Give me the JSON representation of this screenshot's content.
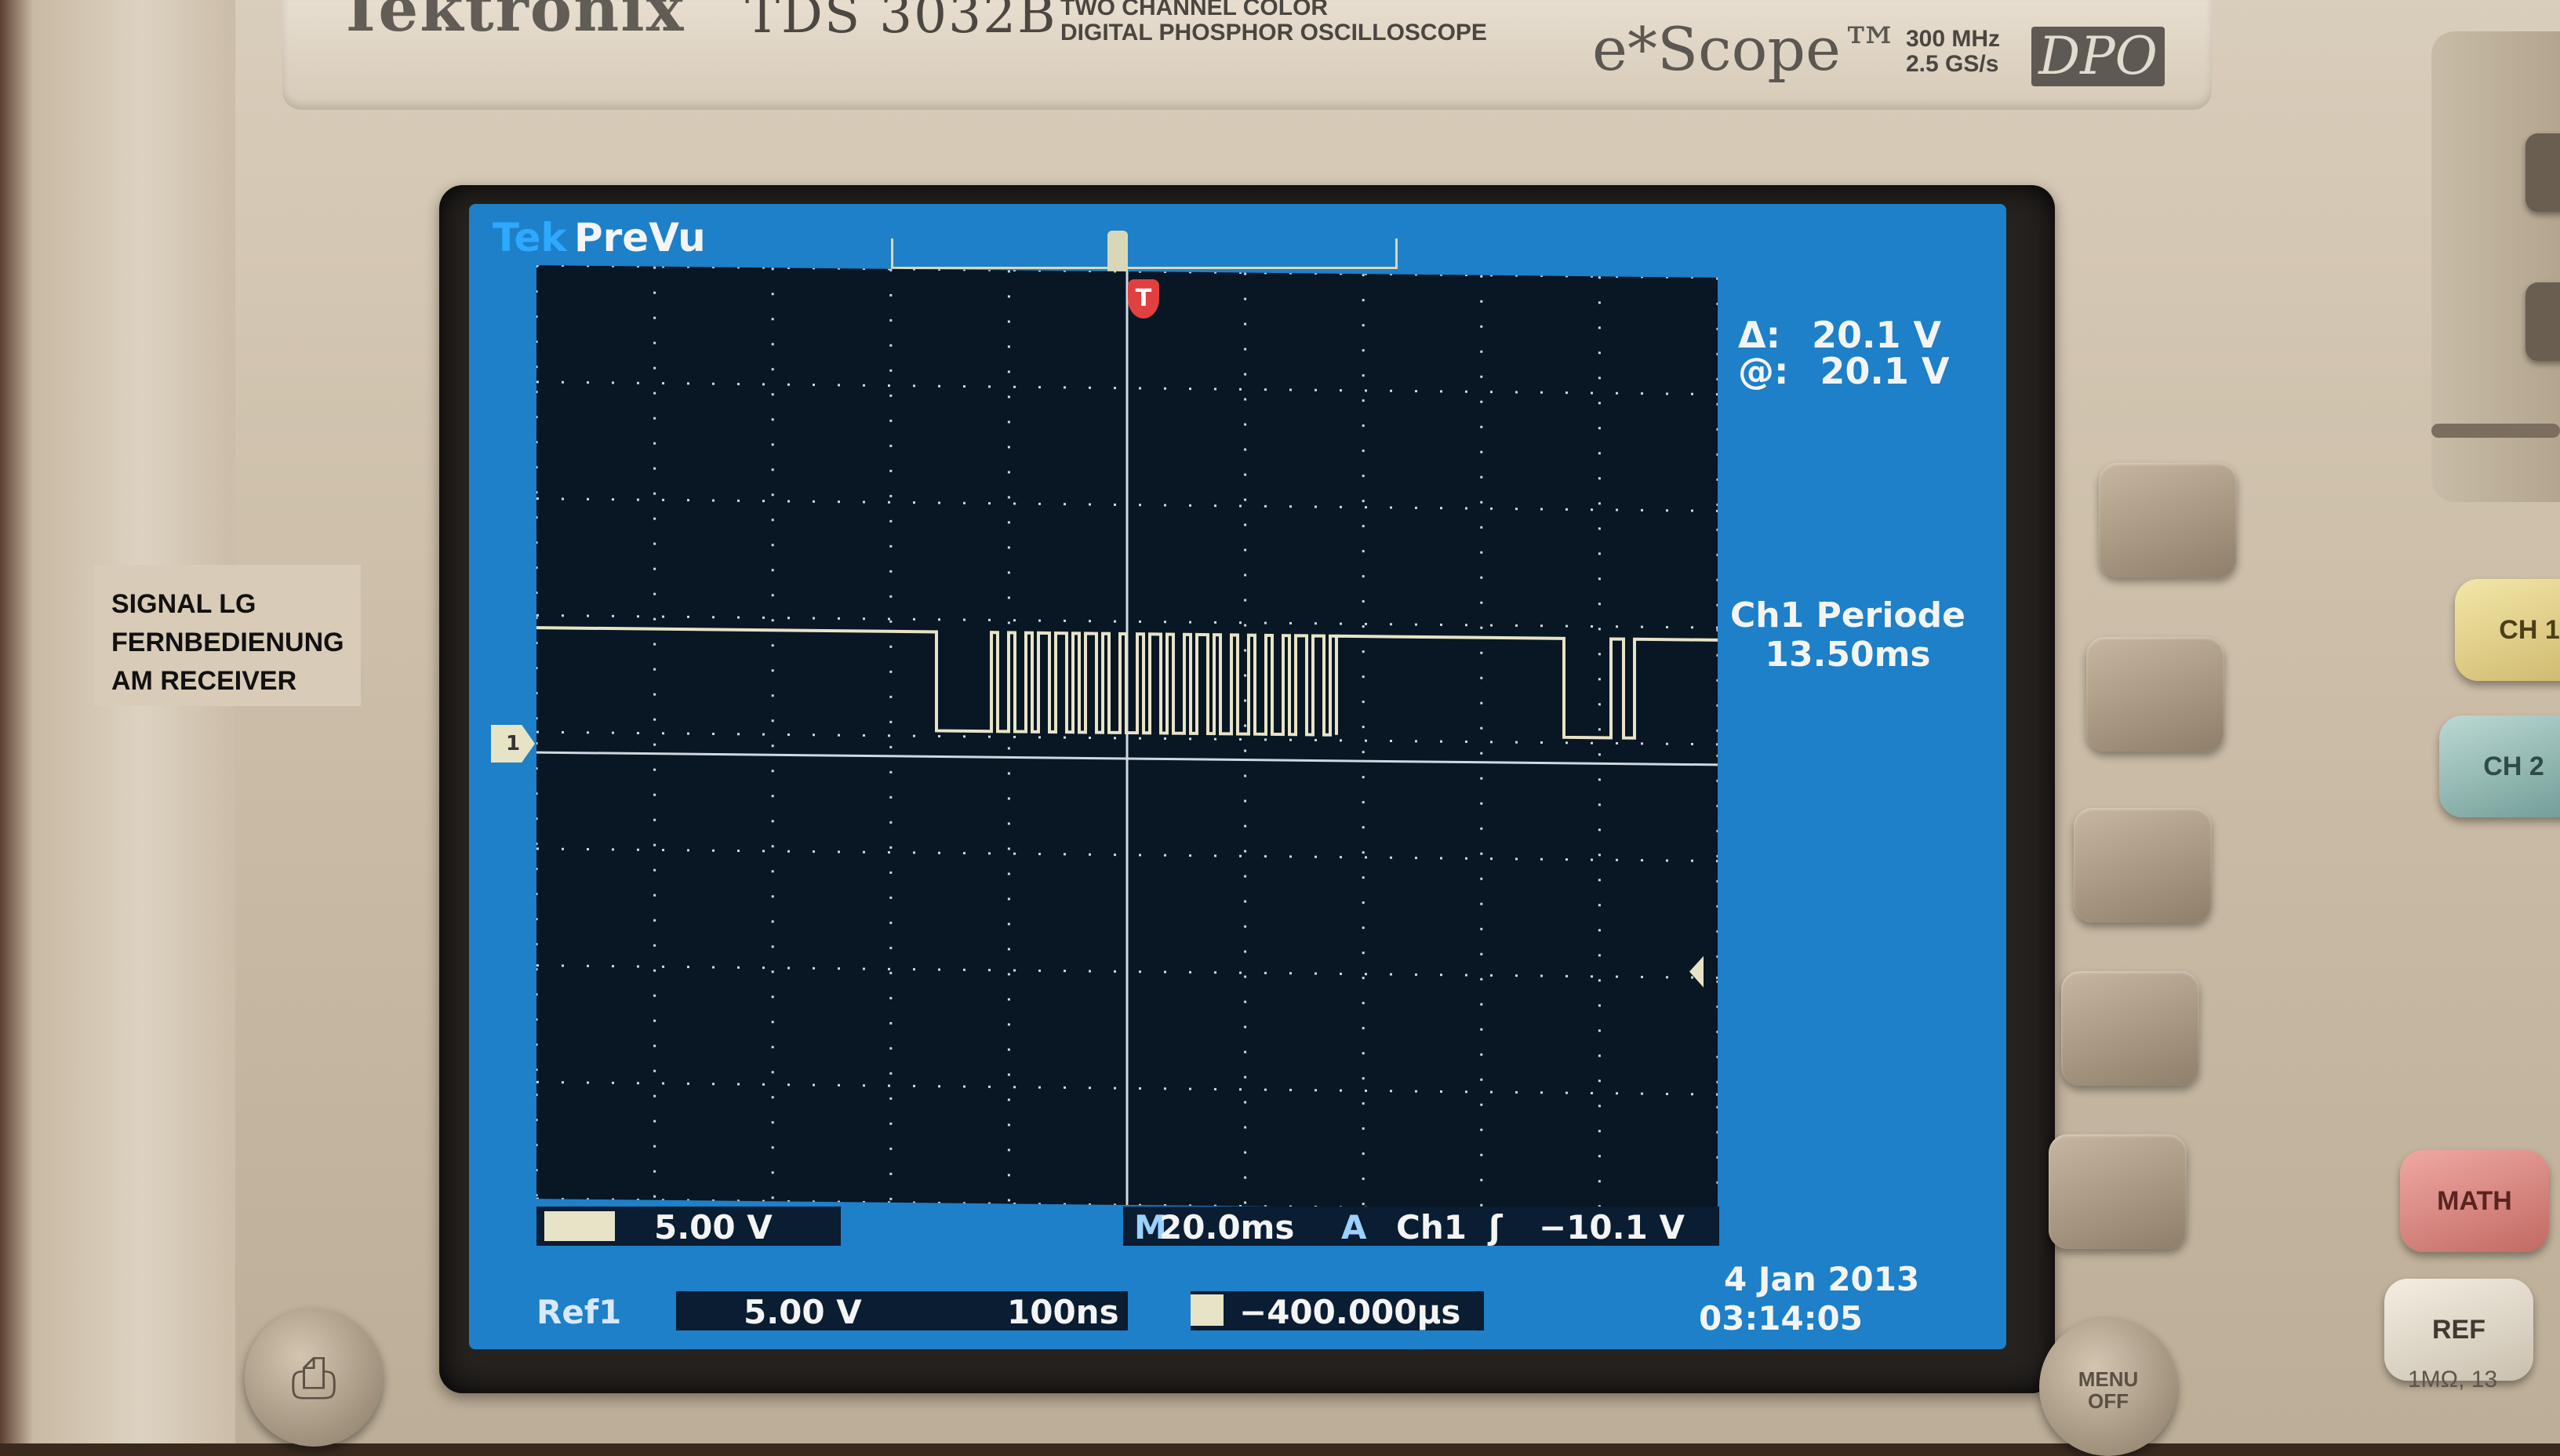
{
  "annotation": {
    "lines": [
      "SIGNAL LG",
      "FERNBEDIENUNG",
      "AM RECEIVER"
    ]
  },
  "scope": {
    "brand": "Tektronix",
    "model": "TDS 3032B",
    "description_line1": "TWO CHANNEL COLOR",
    "description_line2": "DIGITAL PHOSPHOR OSCILLOSCOPE",
    "product_line": "e*Scope™",
    "bandwidth": "300 MHz",
    "sample_rate": "2.5 GS/s",
    "series_badge": "DPO",
    "impedance_label": "1MΩ, 13"
  },
  "screen": {
    "logo": "Tek",
    "mode": "PreVu",
    "trigger_marker": "T",
    "ch1_marker": "1",
    "cursor_delta_label": "Δ:",
    "cursor_delta_value": "20.1 V",
    "cursor_at_label": "@:",
    "cursor_at_value": "20.1 V",
    "measurement_line1": "Ch1 Periode",
    "measurement_line2": "13.50ms",
    "ch1_scale": "5.00 V",
    "horizontal_label": "M",
    "horizontal_scale": "20.0ms",
    "trigger_symbol": "A",
    "trigger_source": "Ch1",
    "trigger_slope": "ʃ",
    "trigger_level": "−10.1 V",
    "ref_label": "Ref1",
    "ref_scale": "5.00 V",
    "ref_time": "100ns",
    "ref_delay": "−400.000µs",
    "date": "4 Jan  2013",
    "time": "03:14:05"
  },
  "buttons": {
    "ch1": "CH 1",
    "ch2": "CH 2",
    "math": "MATH",
    "ref": "REF",
    "menu_line1": "MENU",
    "menu_line2": "OFF",
    "print_icon": "printer-icon"
  },
  "colors": {
    "lcd_background": "#1d80c8",
    "grid_background": "#091624",
    "trace": "#e7e3c6",
    "trigger_marker": "#e04040"
  }
}
